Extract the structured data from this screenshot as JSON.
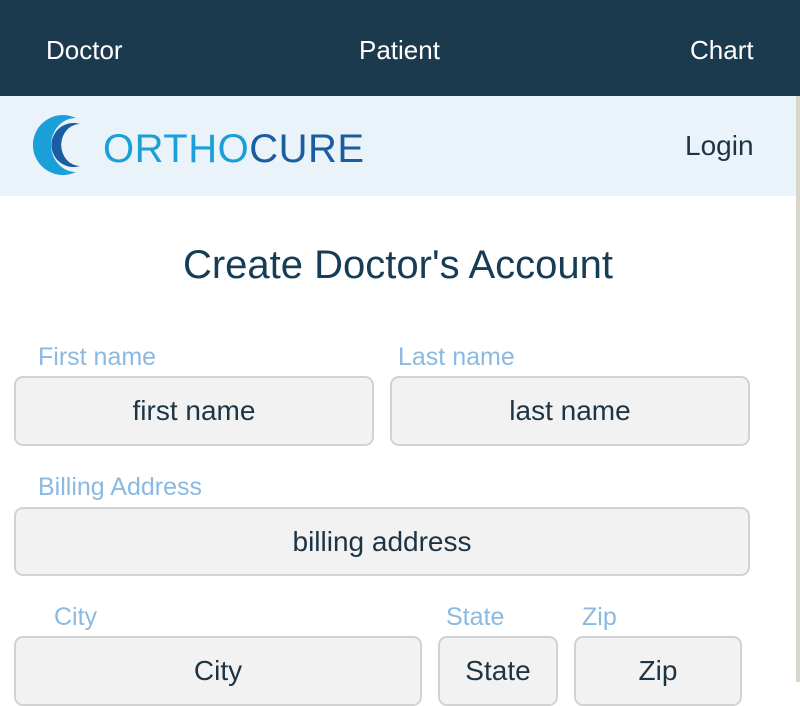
{
  "topnav": {
    "items": [
      {
        "label": "Doctor"
      },
      {
        "label": "Patient"
      },
      {
        "label": "Chart"
      }
    ]
  },
  "brand": {
    "name_part1": "ORTHO",
    "name_part2": "CURE",
    "colors": {
      "light": "#1a9fd8",
      "dark": "#1a5da0"
    }
  },
  "header": {
    "login_label": "Login"
  },
  "form": {
    "title": "Create Doctor's Account",
    "first_name": {
      "label": "First name",
      "placeholder": "first name"
    },
    "last_name": {
      "label": "Last name",
      "placeholder": "last name"
    },
    "billing_address": {
      "label": "Billing Address",
      "placeholder": "billing address"
    },
    "city": {
      "label": "City",
      "placeholder": "City"
    },
    "state": {
      "label": "State",
      "placeholder": "State"
    },
    "zip": {
      "label": "Zip",
      "placeholder": "Zip"
    }
  },
  "theme": {
    "nav_bg": "#1b3a4e",
    "brandbar_bg": "#eaf3fa",
    "label_color": "#8ab9e2",
    "title_color": "#163c56"
  }
}
